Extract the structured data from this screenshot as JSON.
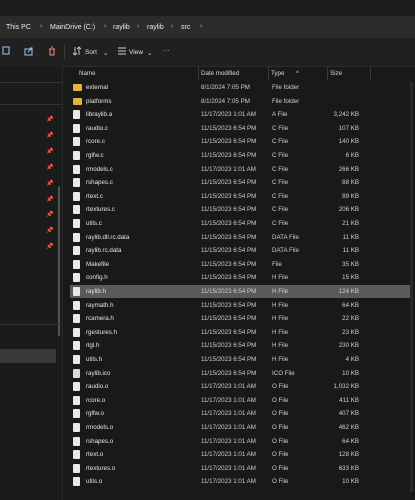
{
  "address": {
    "crumbs": [
      "This PC",
      "MainDrive (C:)",
      "raylib",
      "raylib",
      "src"
    ]
  },
  "toolbar": {
    "sort_label": "Sort",
    "view_label": "View",
    "more_label": "···"
  },
  "columns": {
    "name": "Name",
    "date": "Date modified",
    "type": "Type",
    "size": "Size"
  },
  "files": [
    {
      "name": "external",
      "date": "8/1/2024 7:05 PM",
      "type": "File folder",
      "size": "",
      "kind": "folder"
    },
    {
      "name": "platforms",
      "date": "8/1/2024 7:05 PM",
      "type": "File folder",
      "size": "",
      "kind": "folder"
    },
    {
      "name": "libraylib.a",
      "date": "11/17/2023 1:01 AM",
      "type": "A File",
      "size": "3,242 KB",
      "kind": "file"
    },
    {
      "name": "raudio.c",
      "date": "11/15/2023 6:54 PM",
      "type": "C File",
      "size": "107 KB",
      "kind": "file"
    },
    {
      "name": "rcore.c",
      "date": "11/15/2023 6:54 PM",
      "type": "C File",
      "size": "140 KB",
      "kind": "file"
    },
    {
      "name": "rglfw.c",
      "date": "11/15/2023 6:54 PM",
      "type": "C File",
      "size": "6 KB",
      "kind": "file"
    },
    {
      "name": "rmodels.c",
      "date": "11/17/2023 1:01 AM",
      "type": "C File",
      "size": "266 KB",
      "kind": "file"
    },
    {
      "name": "rshapes.c",
      "date": "11/15/2023 6:54 PM",
      "type": "C File",
      "size": "88 KB",
      "kind": "file"
    },
    {
      "name": "rtext.c",
      "date": "11/15/2023 6:54 PM",
      "type": "C File",
      "size": "89 KB",
      "kind": "file"
    },
    {
      "name": "rtextures.c",
      "date": "11/15/2023 6:54 PM",
      "type": "C File",
      "size": "206 KB",
      "kind": "file"
    },
    {
      "name": "utils.c",
      "date": "11/15/2023 6:54 PM",
      "type": "C File",
      "size": "21 KB",
      "kind": "file"
    },
    {
      "name": "raylib.dll.rc.data",
      "date": "11/15/2023 6:54 PM",
      "type": "DATA File",
      "size": "11 KB",
      "kind": "file"
    },
    {
      "name": "raylib.rc.data",
      "date": "11/15/2023 6:54 PM",
      "type": "DATA File",
      "size": "11 KB",
      "kind": "file"
    },
    {
      "name": "Makefile",
      "date": "11/15/2023 6:54 PM",
      "type": "File",
      "size": "35 KB",
      "kind": "file"
    },
    {
      "name": "config.h",
      "date": "11/15/2023 6:54 PM",
      "type": "H File",
      "size": "15 KB",
      "kind": "file"
    },
    {
      "name": "raylib.h",
      "date": "11/15/2023 6:54 PM",
      "type": "H File",
      "size": "124 KB",
      "kind": "file",
      "selected": true
    },
    {
      "name": "raymath.h",
      "date": "11/15/2023 6:54 PM",
      "type": "H File",
      "size": "64 KB",
      "kind": "file"
    },
    {
      "name": "rcamera.h",
      "date": "11/15/2023 6:54 PM",
      "type": "H File",
      "size": "22 KB",
      "kind": "file"
    },
    {
      "name": "rgestures.h",
      "date": "11/15/2023 6:54 PM",
      "type": "H File",
      "size": "23 KB",
      "kind": "file"
    },
    {
      "name": "rlgl.h",
      "date": "11/15/2023 6:54 PM",
      "type": "H File",
      "size": "230 KB",
      "kind": "file"
    },
    {
      "name": "utils.h",
      "date": "11/15/2023 6:54 PM",
      "type": "H File",
      "size": "4 KB",
      "kind": "file"
    },
    {
      "name": "raylib.ico",
      "date": "11/15/2023 6:54 PM",
      "type": "ICO File",
      "size": "10 KB",
      "kind": "ico"
    },
    {
      "name": "raudio.o",
      "date": "11/17/2023 1:01 AM",
      "type": "O File",
      "size": "1,032 KB",
      "kind": "file"
    },
    {
      "name": "rcore.o",
      "date": "11/17/2023 1:01 AM",
      "type": "O File",
      "size": "411 KB",
      "kind": "file"
    },
    {
      "name": "rglfw.o",
      "date": "11/17/2023 1:01 AM",
      "type": "O File",
      "size": "407 KB",
      "kind": "file"
    },
    {
      "name": "rmodels.o",
      "date": "11/17/2023 1:01 AM",
      "type": "O File",
      "size": "462 KB",
      "kind": "file"
    },
    {
      "name": "rshapes.o",
      "date": "11/17/2023 1:01 AM",
      "type": "O File",
      "size": "64 KB",
      "kind": "file"
    },
    {
      "name": "rtext.o",
      "date": "11/17/2023 1:01 AM",
      "type": "O File",
      "size": "128 KB",
      "kind": "file"
    },
    {
      "name": "rtextures.o",
      "date": "11/17/2023 1:01 AM",
      "type": "O File",
      "size": "633 KB",
      "kind": "file"
    },
    {
      "name": "utils.o",
      "date": "11/17/2023 1:01 AM",
      "type": "O File",
      "size": "10 KB",
      "kind": "file"
    }
  ]
}
